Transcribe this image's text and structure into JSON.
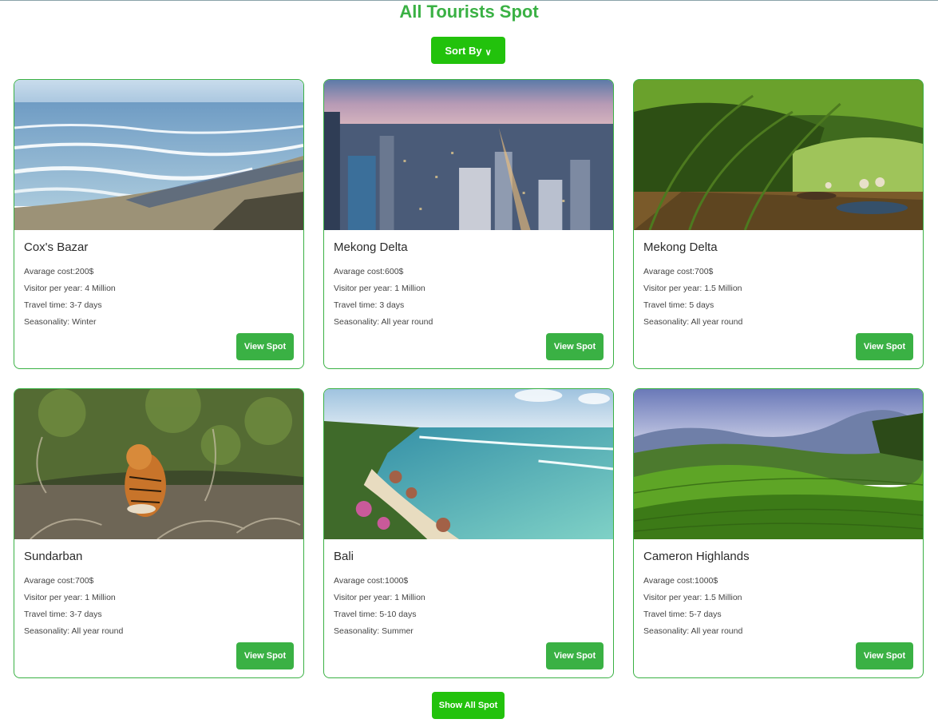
{
  "page": {
    "title": "All Tourists Spot",
    "sort_label": "Sort By",
    "sort_icon": "chevron-down-icon",
    "show_all_label": "Show All Spot",
    "accent_color": "#3ab144",
    "button_color": "#22c20c"
  },
  "spots": [
    {
      "name": "Cox's Bazar",
      "cost": "Avarage cost:200$",
      "visitors": "Visitor per year: 4 Million",
      "travel": "Travel time: 3-7 days",
      "season": "Seasonality: Winter",
      "button": "View Spot",
      "image": "beach-photo"
    },
    {
      "name": "Mekong Delta",
      "cost": "Avarage cost:600$",
      "visitors": "Visitor per year: 1 Million",
      "travel": "Travel time: 3 days",
      "season": "Seasonality: All year round",
      "button": "View Spot",
      "image": "city-skyline-photo"
    },
    {
      "name": "Mekong Delta",
      "cost": "Avarage cost:700$",
      "visitors": "Visitor per year: 1.5 Million",
      "travel": "Travel time: 5 days",
      "season": "Seasonality: All year round",
      "button": "View Spot",
      "image": "palm-canal-boats-photo"
    },
    {
      "name": "Sundarban",
      "cost": "Avarage cost:700$",
      "visitors": "Visitor per year: 1 Million",
      "travel": "Travel time: 3-7 days",
      "season": "Seasonality: All year round",
      "button": "View Spot",
      "image": "tiger-mangrove-photo"
    },
    {
      "name": "Bali",
      "cost": "Avarage cost:1000$",
      "visitors": "Visitor per year: 1 Million",
      "travel": "Travel time: 5-10 days",
      "season": "Seasonality: Summer",
      "button": "View Spot",
      "image": "bali-coast-photo"
    },
    {
      "name": "Cameron Highlands",
      "cost": "Avarage cost:1000$",
      "visitors": "Visitor per year: 1.5 Million",
      "travel": "Travel time: 5-7 days",
      "season": "Seasonality: All year round",
      "button": "View Spot",
      "image": "tea-hills-photo"
    }
  ]
}
